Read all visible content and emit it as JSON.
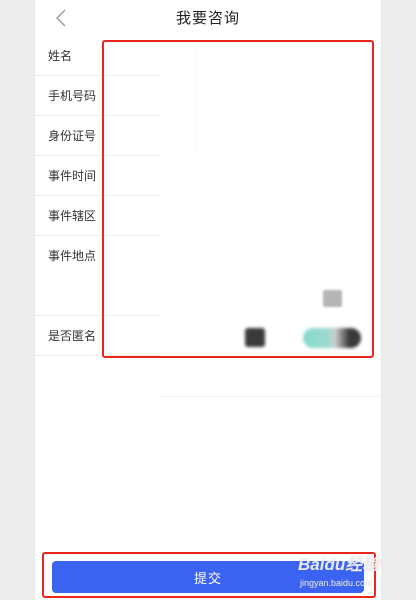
{
  "header": {
    "title": "我要咨询"
  },
  "form": {
    "fields": [
      {
        "label": "姓名"
      },
      {
        "label": "手机号码"
      },
      {
        "label": "身份证号"
      },
      {
        "label": "事件时间"
      },
      {
        "label": "事件辖区"
      },
      {
        "label": "事件地点"
      },
      {
        "label": "是否匿名"
      }
    ]
  },
  "submit": {
    "label": "提交"
  },
  "watermark": {
    "logo_text": "Baidu经验",
    "sub_text": "jingyan.baidu.com"
  },
  "colors": {
    "primary": "#3b63f2",
    "highlight": "#e8261e",
    "toggle_on": "#84dccd"
  }
}
